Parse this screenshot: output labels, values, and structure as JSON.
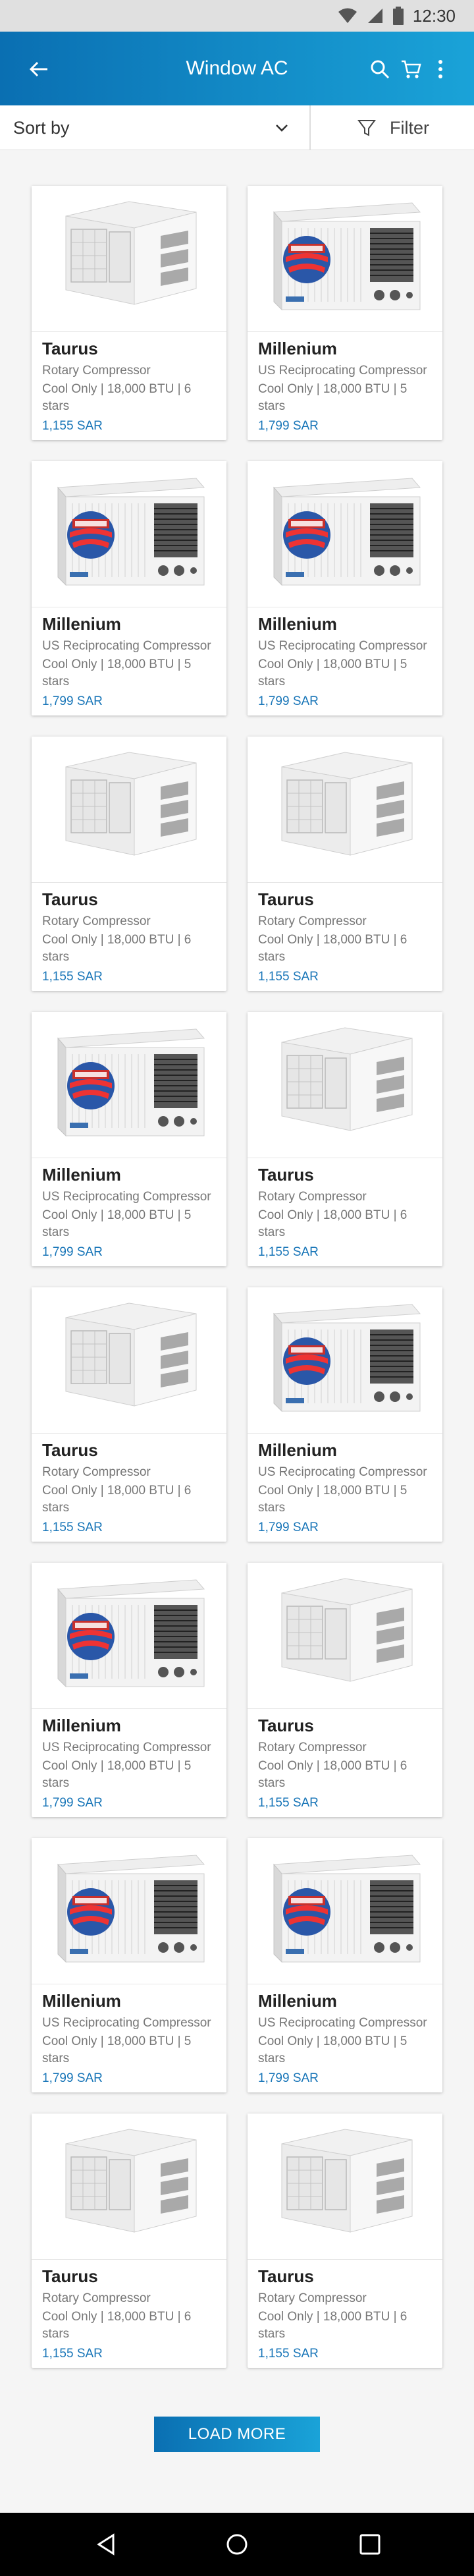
{
  "status": {
    "time": "12:30",
    "icons": [
      "wifi-icon",
      "signal-icon",
      "battery-icon"
    ]
  },
  "app_bar": {
    "title": "Window AC",
    "icons": [
      "back-arrow-icon",
      "search-icon",
      "cart-icon",
      "more-vert-icon"
    ]
  },
  "toolbar": {
    "sort_label": "Sort by",
    "filter_label": "Filter"
  },
  "products": [
    {
      "name": "Taurus",
      "subtitle": "Rotary Compressor",
      "spec": "Cool Only | 18,000 BTU | 6 stars",
      "price": "1,155 SAR",
      "image": "taurus"
    },
    {
      "name": "Millenium",
      "subtitle": "US Reciprocating Compressor",
      "spec": "Cool Only | 18,000 BTU | 5 stars",
      "price": "1,799 SAR",
      "image": "millenium"
    },
    {
      "name": "Millenium",
      "subtitle": "US Reciprocating Compressor",
      "spec": "Cool Only | 18,000 BTU | 5 stars",
      "price": "1,799 SAR",
      "image": "millenium"
    },
    {
      "name": "Millenium",
      "subtitle": "US Reciprocating Compressor",
      "spec": "Cool Only | 18,000 BTU | 5 stars",
      "price": "1,799 SAR",
      "image": "millenium"
    },
    {
      "name": "Taurus",
      "subtitle": "Rotary Compressor",
      "spec": "Cool Only | 18,000 BTU | 6 stars",
      "price": "1,155 SAR",
      "image": "taurus"
    },
    {
      "name": "Taurus",
      "subtitle": "Rotary Compressor",
      "spec": "Cool Only | 18,000 BTU | 6 stars",
      "price": "1,155 SAR",
      "image": "taurus"
    },
    {
      "name": "Millenium",
      "subtitle": "US Reciprocating Compressor",
      "spec": "Cool Only | 18,000 BTU | 5 stars",
      "price": "1,799 SAR",
      "image": "millenium"
    },
    {
      "name": "Taurus",
      "subtitle": "Rotary Compressor",
      "spec": "Cool Only | 18,000 BTU | 6 stars",
      "price": "1,155 SAR",
      "image": "taurus"
    },
    {
      "name": "Taurus",
      "subtitle": "Rotary Compressor",
      "spec": "Cool Only | 18,000 BTU | 6 stars",
      "price": "1,155 SAR",
      "image": "taurus"
    },
    {
      "name": "Millenium",
      "subtitle": "US Reciprocating Compressor",
      "spec": "Cool Only | 18,000 BTU | 5 stars",
      "price": "1,799 SAR",
      "image": "millenium"
    },
    {
      "name": "Millenium",
      "subtitle": "US Reciprocating Compressor",
      "spec": "Cool Only | 18,000 BTU | 5 stars",
      "price": "1,799 SAR",
      "image": "millenium"
    },
    {
      "name": "Taurus",
      "subtitle": "Rotary Compressor",
      "spec": "Cool Only | 18,000 BTU | 6 stars",
      "price": "1,155 SAR",
      "image": "taurus"
    },
    {
      "name": "Millenium",
      "subtitle": "US Reciprocating Compressor",
      "spec": "Cool Only | 18,000 BTU | 5 stars",
      "price": "1,799 SAR",
      "image": "millenium"
    },
    {
      "name": "Millenium",
      "subtitle": "US Reciprocating Compressor",
      "spec": "Cool Only | 18,000 BTU | 5 stars",
      "price": "1,799 SAR",
      "image": "millenium"
    },
    {
      "name": "Taurus",
      "subtitle": "Rotary Compressor",
      "spec": "Cool Only | 18,000 BTU | 6 stars",
      "price": "1,155 SAR",
      "image": "taurus"
    },
    {
      "name": "Taurus",
      "subtitle": "Rotary Compressor",
      "spec": "Cool Only | 18,000 BTU | 6 stars",
      "price": "1,155 SAR",
      "image": "taurus"
    }
  ],
  "load_more_label": "LOAD MORE",
  "nav": {
    "icons": [
      "back-triangle-icon",
      "home-circle-icon",
      "recents-square-icon"
    ]
  },
  "colors": {
    "accent_start": "#0a6fb2",
    "accent_end": "#1aa3d8",
    "price": "#1976b8"
  }
}
